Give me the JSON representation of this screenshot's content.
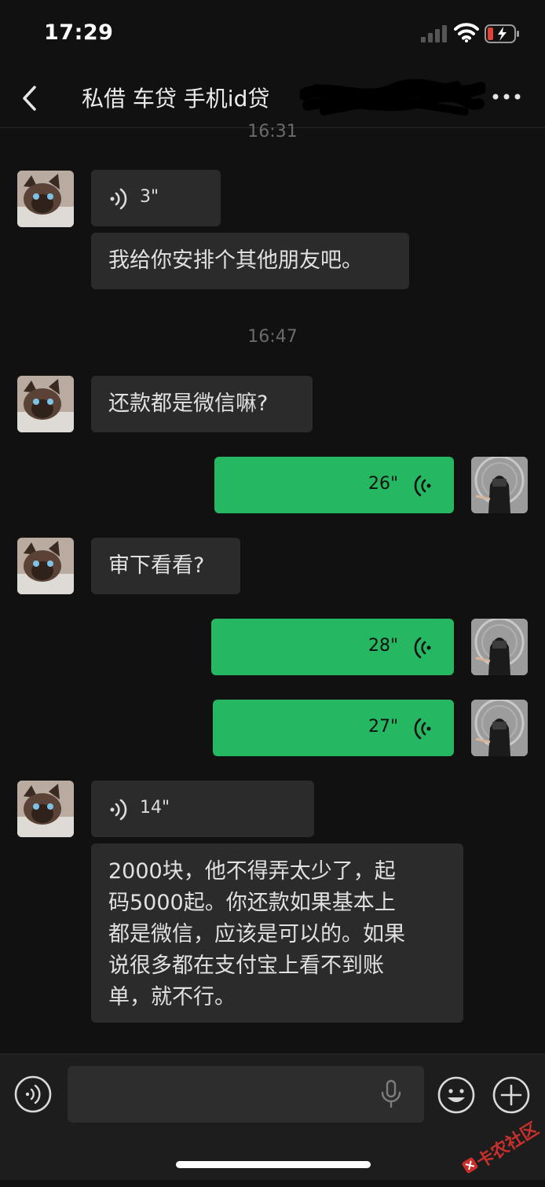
{
  "status_bar": {
    "time": "17:29"
  },
  "header": {
    "title": "私借 车贷 手机id贷"
  },
  "messages": {
    "ts1": "16:31",
    "m1_voice": "3\"",
    "m1_text": "我给你安排个其他朋友吧。",
    "ts2": "16:47",
    "m2_text": "还款都是微信嘛?",
    "m3_voice": "26\"",
    "m4_text": "审下看看?",
    "m5_voice": "28\"",
    "m6_voice": "27\"",
    "m7_voice": "14\"",
    "m7_line1": "2000块，他不得弄太少了，起",
    "m7_line2": "码5000起。你还款如果基本上",
    "m7_line3": "都是微信，应该是可以的。如果",
    "m7_line4": "说很多都在支付宝上看不到账",
    "m7_line5": "单，就不行。"
  },
  "input": {
    "placeholder": ""
  },
  "watermark": {
    "text": "卡农社区"
  },
  "icons": {
    "back": "chevron-left-icon",
    "more": "more-dots-icon",
    "voice_toggle": "voice-mode-icon",
    "mic": "mic-icon",
    "emoji": "emoji-icon",
    "plus": "plus-icon"
  },
  "colors": {
    "background": "#111111",
    "incoming_bubble": "#2b2b2b",
    "outgoing_bubble": "#25b761",
    "battery_low": "#e0413a"
  }
}
